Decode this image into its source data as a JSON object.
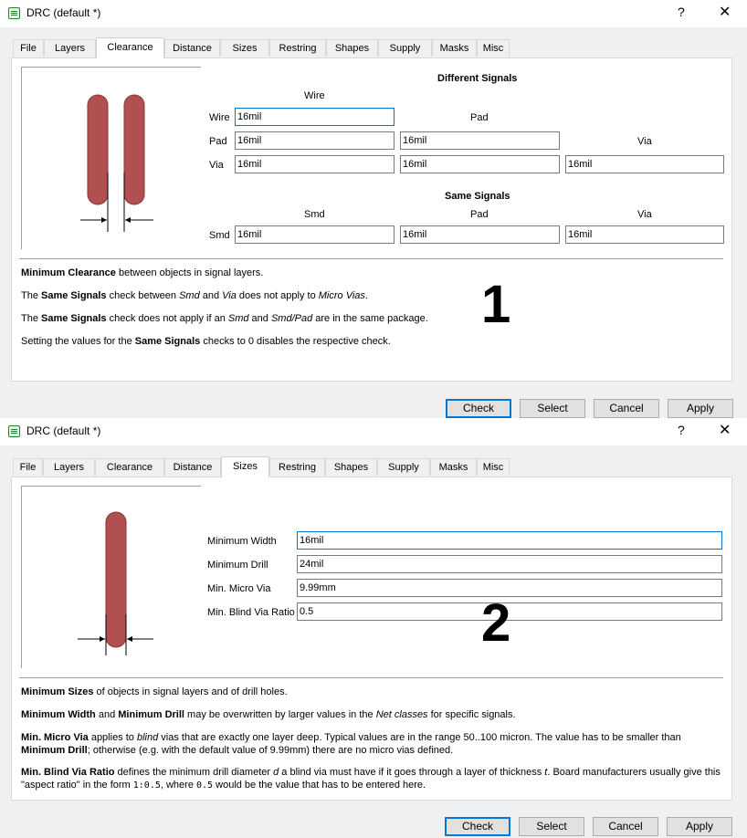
{
  "dialog1": {
    "title": "DRC (default *)",
    "help_icon": "?",
    "close_icon": "✕",
    "tabs": [
      "File",
      "Layers",
      "Clearance",
      "Distance",
      "Sizes",
      "Restring",
      "Shapes",
      "Supply",
      "Masks",
      "Misc"
    ],
    "active_tab": "Clearance",
    "different_signals": {
      "header": "Different Signals",
      "col_wire": "Wire",
      "col_pad": "Pad",
      "col_via": "Via",
      "row_wire": "Wire",
      "row_pad": "Pad",
      "row_via": "Via",
      "wire_wire": "16mil",
      "pad_wire": "16mil",
      "pad_pad": "16mil",
      "via_wire": "16mil",
      "via_pad": "16mil",
      "via_via": "16mil"
    },
    "same_signals": {
      "header": "Same Signals",
      "col_smd": "Smd",
      "col_pad": "Pad",
      "col_via": "Via",
      "row_smd": "Smd",
      "smd_smd": "16mil",
      "smd_pad": "16mil",
      "smd_via": "16mil"
    },
    "help": {
      "l1_b": "Minimum Clearance",
      "l1_t": " between objects in signal layers.",
      "l2_a": "The ",
      "l2_b": "Same Signals",
      "l2_c": " check between ",
      "l2_i1": "Smd",
      "l2_d": " and ",
      "l2_i2": "Via",
      "l2_e": " does not apply to ",
      "l2_i3": "Micro Vias",
      "l2_f": ".",
      "l3_a": "The ",
      "l3_b": "Same Signals",
      "l3_c": " check does not apply if an ",
      "l3_i1": "Smd",
      "l3_d": " and ",
      "l3_i2": "Smd/Pad",
      "l3_e": " are in the same package.",
      "l4_a": "Setting the values for the ",
      "l4_b": "Same Signals",
      "l4_c": " checks to 0 disables the respective check."
    },
    "annotation": "1",
    "buttons": {
      "check": "Check",
      "select": "Select",
      "cancel": "Cancel",
      "apply": "Apply"
    }
  },
  "dialog2": {
    "title": "DRC (default *)",
    "help_icon": "?",
    "close_icon": "✕",
    "tabs": [
      "File",
      "Layers",
      "Clearance",
      "Distance",
      "Sizes",
      "Restring",
      "Shapes",
      "Supply",
      "Masks",
      "Misc"
    ],
    "active_tab": "Sizes",
    "fields": {
      "min_width_label": "Minimum Width",
      "min_width": "16mil",
      "min_drill_label": "Minimum Drill",
      "min_drill": "24mil",
      "min_micro_via_label": "Min. Micro Via",
      "min_micro_via": "9.99mm",
      "min_blind_via_label": "Min. Blind Via Ratio",
      "min_blind_via": "0.5"
    },
    "help": {
      "l1_b": "Minimum Sizes",
      "l1_t": " of objects in signal layers and of drill holes.",
      "l2_b1": "Minimum Width",
      "l2_a": " and ",
      "l2_b2": "Minimum Drill",
      "l2_c": " may be overwritten by larger values in the ",
      "l2_i": "Net classes",
      "l2_d": " for specific signals.",
      "l3_b1": "Min. Micro Via",
      "l3_a": " applies to ",
      "l3_i": "blind",
      "l3_c": " vias that are exactly one layer deep. Typical values are in the range 50..100 micron. The value has to be smaller than ",
      "l3_b2": "Minimum Drill",
      "l3_d": "; otherwise (e.g. with the default value of 9.99mm) there are no micro vias defined.",
      "l4_b": "Min. Blind Via Ratio",
      "l4_a": " defines the minimum drill diameter ",
      "l4_i1": "d",
      "l4_c": " a blind via must have if it goes through a layer of thickness ",
      "l4_i2": "t",
      "l4_d": ". Board manufacturers usually give this \"aspect ratio\" in the form ",
      "l4_m1": "1:0.5",
      "l4_e": ", where ",
      "l4_m2": "0.5",
      "l4_f": " would be the value that has to be entered here."
    },
    "annotation": "2",
    "buttons": {
      "check": "Check",
      "select": "Select",
      "cancel": "Cancel",
      "apply": "Apply"
    }
  },
  "colors": {
    "trace": "#b05050",
    "accent": "#0078d7"
  }
}
